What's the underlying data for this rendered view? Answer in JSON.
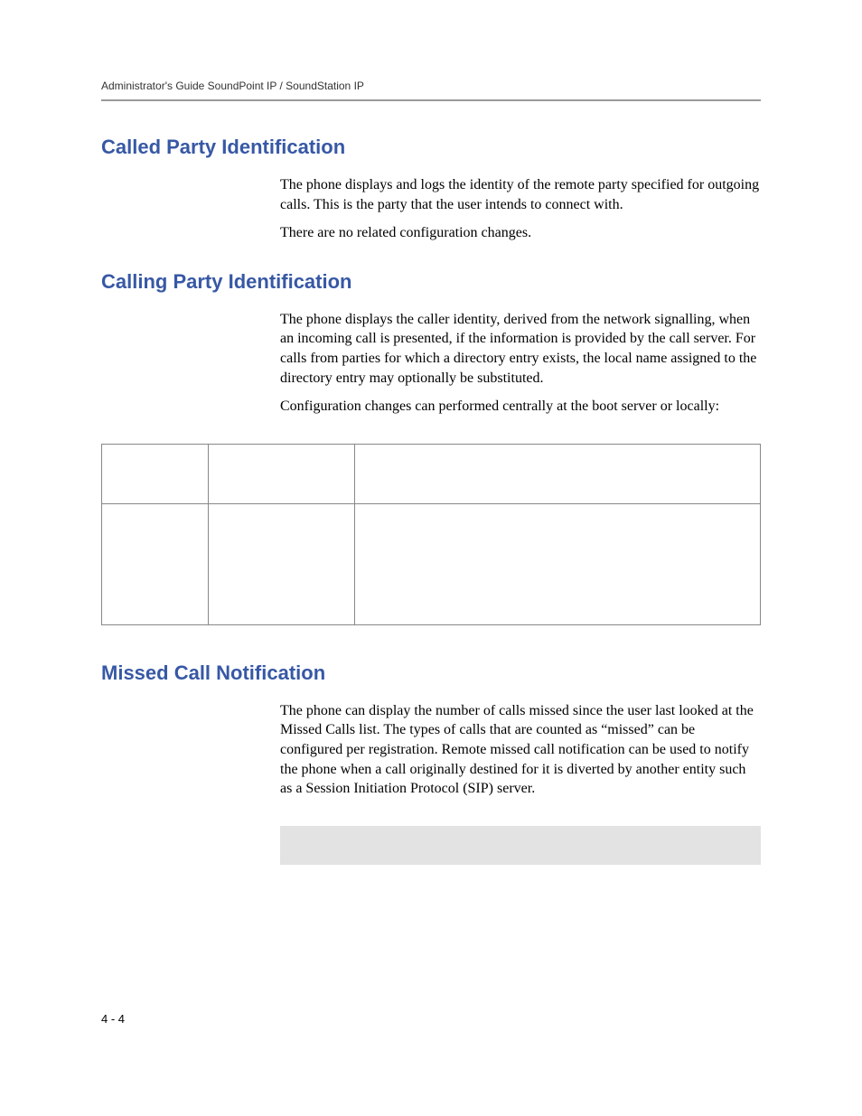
{
  "header": {
    "running_title": "Administrator's Guide SoundPoint IP / SoundStation IP"
  },
  "sections": {
    "called_party": {
      "heading": "Called Party Identification",
      "p1": "The phone displays and logs the identity of the remote party specified for outgoing calls. This is the party that the user intends to connect with.",
      "p2": "There are no related configuration changes."
    },
    "calling_party": {
      "heading": "Calling Party Identification",
      "p1": "The phone displays the caller identity, derived from the network signalling, when an incoming call is presented, if the information is provided by the call server. For calls from parties for which a directory entry exists, the local name assigned to the directory entry may optionally be substituted.",
      "p2": "Configuration changes can performed centrally at the boot server or locally:"
    },
    "missed_call": {
      "heading": "Missed Call Notification",
      "p1": "The phone can display the number of calls missed since the user last looked at the Missed Calls list. The types of calls that are counted as “missed” can be configured per registration. Remote missed call notification can be used to notify the phone when a call originally destined for it is diverted by another entity such as a Session Initiation Protocol (SIP) server."
    }
  },
  "footer": {
    "page_number": "4 - 4"
  }
}
